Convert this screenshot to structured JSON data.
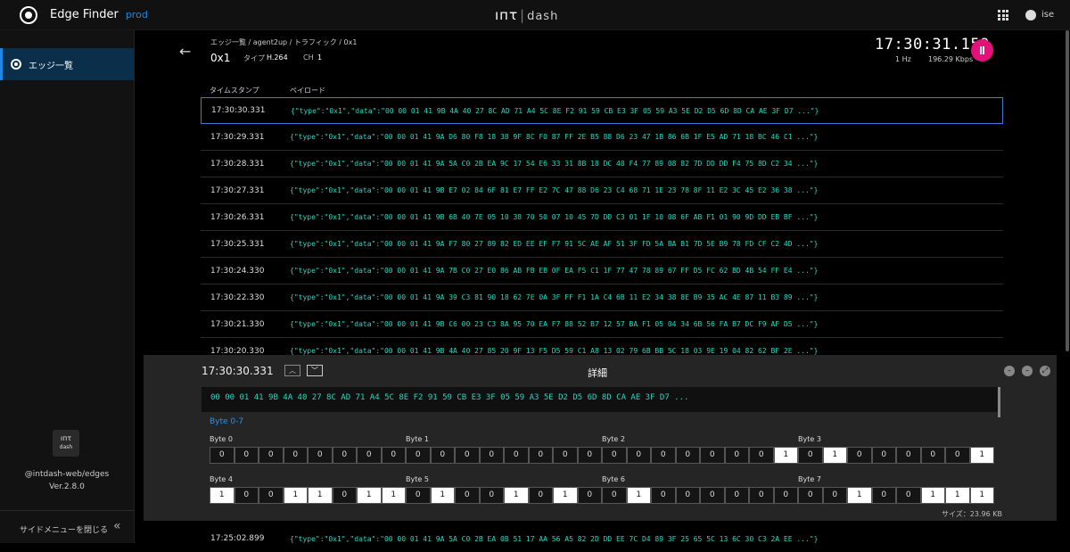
{
  "app": {
    "title": "Edge Finder",
    "env": "prod",
    "brand_left": "ıпτ",
    "brand_right": "dash",
    "user": "ise"
  },
  "sidebar": {
    "items": [
      {
        "label": "エッジ一覧"
      }
    ],
    "logo_line1": "ıпτ",
    "logo_line2": "dash",
    "package": "@intdash-web/edges",
    "version": "Ver.2.8.0",
    "close_label": "サイドメニューを閉じる"
  },
  "header": {
    "breadcrumb": "エッジ一覧 / agent2up / トラフィック / 0x1",
    "title": "0x1",
    "type_label": "タイプ",
    "type_value": "H.264",
    "ch_label": "CH",
    "ch_value": "1",
    "clock": "17:30:31.159",
    "rate": "1 Hz",
    "bandwidth": "196.29 Kbps"
  },
  "table": {
    "columns": [
      "タイムスタンプ",
      "ペイロード"
    ],
    "rows": [
      {
        "ts": "17:30:30.331",
        "payload": "{\"type\":\"0x1\",\"data\":\"00 00 01 41 9B 4A 40 27 8C AD 71 A4 5C 8E F2 91 59 CB E3 3F 05 59 A3 5E D2 D5 6D 8D CA AE 3F D7 ...\"}"
      },
      {
        "ts": "17:30:29.331",
        "payload": "{\"type\":\"0x1\",\"data\":\"00 00 01 41 9A D6 80 F8 18 38 9F 8C F0 87 FF 2E B5 88 D6 23 47 1B 86 6B 1F E5 AD 71 18 BC 46 C1 ...\"}"
      },
      {
        "ts": "17:30:28.331",
        "payload": "{\"type\":\"0x1\",\"data\":\"00 00 01 41 9A 5A C0 2B EA 9C 17 54 E6 33 31 8B 18 DC 48 F4 77 89 08 82 7D DD DD F4 75 8D C2 34 ...\"}"
      },
      {
        "ts": "17:30:27.331",
        "payload": "{\"type\":\"0x1\",\"data\":\"00 00 01 41 9B E7 02 84 6F 81 E7 FF E2 7C 47 88 D6 23 C4 68 71 1E 23 78 8F 11 E2 3C 45 E2 36 38 ...\"}"
      },
      {
        "ts": "17:30:26.331",
        "payload": "{\"type\":\"0x1\",\"data\":\"00 00 01 41 9B 6B 40 7E 05 10 38 70 50 07 10 45 7D DD C3 01 1F 10 08 6F AB F1 01 90 9D DD EB BF ...\"}"
      },
      {
        "ts": "17:30:25.331",
        "payload": "{\"type\":\"0x1\",\"data\":\"00 00 01 41 9A F7 80 27 89 82 ED EE EF F7 91 5C AE AF 51 3F FD 5A BA B1 7D 5E B9 78 FD CF C2 4D ...\"}"
      },
      {
        "ts": "17:30:24.330",
        "payload": "{\"type\":\"0x1\",\"data\":\"00 00 01 41 9A 7B C0 27 E0 86 AB FB EB 0F EA F5 C1 1F 77 47 78 89 67 FF D5 FC 62 BD 4B 54 FF E4 ...\"}"
      },
      {
        "ts": "17:30:22.330",
        "payload": "{\"type\":\"0x1\",\"data\":\"00 00 01 41 9A 39 C3 81 90 18 62 7E 0A 3F FF F1 1A C4 6B 11 E2 34 38 8E B9 35 AC 4E 87 11 B3 89 ...\"}"
      },
      {
        "ts": "17:30:21.330",
        "payload": "{\"type\":\"0x1\",\"data\":\"00 00 01 41 9B C6 00 23 C3 8A 95 70 EA F7 88 52 B7 12 57 BA F1 05 04 34 6B 56 FA B7 DC F9 AF D5 ...\"}"
      },
      {
        "ts": "17:30:20.330",
        "payload": "{\"type\":\"0x1\",\"data\":\"00 00 01 41 9B 4A 40 27 85 20 9F 13 F5 D5 59 C1 A8 13 02 79 6B BB 5C 18 03 9E 19 04 82 62 BF 2E ...\"}"
      }
    ],
    "last_row": {
      "ts": "17:25:02.899",
      "payload": "{\"type\":\"0x1\",\"data\":\"00 00 01 41 9A 5A C0 2B EA 0B 51 17 AA 56 A5 82 2D DD EE 7C D4 89 3F 25 65 5C 13 6C 30 C3 2A EE ...\"}"
    }
  },
  "detail": {
    "timestamp": "17:30:30.331",
    "title": "詳細",
    "up_glyph": "︿",
    "down_glyph": "﹀",
    "hex": "00 00 01 41 9B 4A 40 27 8C AD 71 A4 5C 8E F2 91 59 CB E3 3F 05 59 A3 5E D2 D5 6D 8D CA AE 3F D7 ...",
    "section": "Byte 0-7",
    "bytes": [
      {
        "label": "Byte 0",
        "bits": "00000000"
      },
      {
        "label": "Byte 1",
        "bits": "00000000"
      },
      {
        "label": "Byte 2",
        "bits": "00000001"
      },
      {
        "label": "Byte 3",
        "bits": "01000001"
      },
      {
        "label": "Byte 4",
        "bits": "10011011"
      },
      {
        "label": "Byte 5",
        "bits": "01001010"
      },
      {
        "label": "Byte 6",
        "bits": "01000000"
      },
      {
        "label": "Byte 7",
        "bits": "00100111"
      }
    ],
    "size": "サイズ：23.96 KB"
  },
  "icons": {
    "app": "app-target-icon",
    "grid": "grid-icon",
    "user": "user-icon",
    "back": "arrow-left-icon",
    "pause": "pause-icon",
    "collapse": "double-chevron-left-icon"
  },
  "colors": {
    "accent": "#1e88e5",
    "payload": "#26d7c0",
    "pause": "#e2127a",
    "selected_border": "#3c7bd0"
  }
}
